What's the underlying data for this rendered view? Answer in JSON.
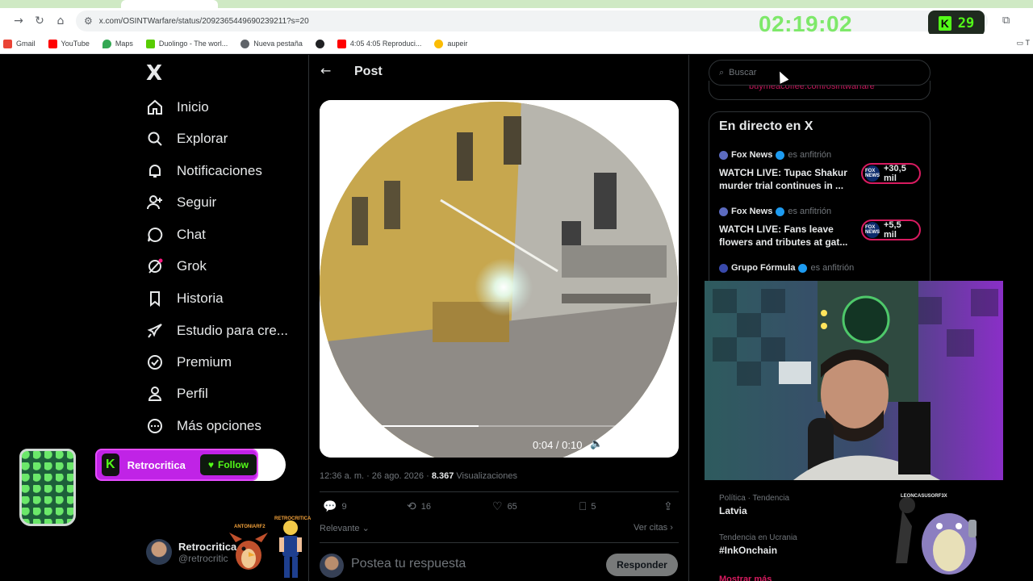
{
  "browser": {
    "url": "x.com/OSINTWarfare/status/2092365449690239211?s=20",
    "timer": "02:19:02",
    "kick_badge": "K",
    "kick_count": "29",
    "bookmarks": [
      {
        "label": "Gmail",
        "color": "#ea4335"
      },
      {
        "label": "YouTube",
        "color": "#ff0000"
      },
      {
        "label": "Maps",
        "color": "#34a853"
      },
      {
        "label": "Duolingo - The worl...",
        "color": "#58cc02"
      },
      {
        "label": "Nueva pestaña",
        "color": "#5f6368"
      },
      {
        "label": "",
        "color": "#202124"
      },
      {
        "label": "4:05 4:05 Reproduci...",
        "color": "#ff0000"
      },
      {
        "label": "aupeir",
        "color": "#fbbc04"
      }
    ],
    "bookmarks_more": "T"
  },
  "x": {
    "logo": "X",
    "nav": [
      {
        "label": "Inicio",
        "icon": "home-icon"
      },
      {
        "label": "Explorar",
        "icon": "search-icon"
      },
      {
        "label": "Notificaciones",
        "icon": "bell-icon"
      },
      {
        "label": "Seguir",
        "icon": "follow-icon"
      },
      {
        "label": "Chat",
        "icon": "chat-icon"
      },
      {
        "label": "Grok",
        "icon": "grok-icon"
      },
      {
        "label": "Historia",
        "icon": "bookmark-icon"
      },
      {
        "label": "Estudio para cre...",
        "icon": "rocket-icon"
      },
      {
        "label": "Premium",
        "icon": "verified-icon"
      },
      {
        "label": "Perfil",
        "icon": "person-icon"
      },
      {
        "label": "Más opciones",
        "icon": "more-icon"
      }
    ],
    "account": {
      "name": "Retrocritica",
      "handle": "@retrocritic"
    },
    "post": {
      "title": "Post",
      "video_time": "0:04 / 0:10",
      "progress": 0.44,
      "timestamp": "12:36 a. m. · 26 ago. 2026 · ",
      "views_count": "8.367",
      "views_label": "Visualizaciones",
      "replies": "9",
      "reposts": "16",
      "likes": "65",
      "bookmarks": "5",
      "sort_label": "Relevante",
      "quotes_label": "Ver citas",
      "reply_placeholder": "Postea tu respuesta",
      "reply_button": "Responder"
    },
    "search_placeholder": "Buscar",
    "peek_text": "buymeacoffee.com/osintwarfare",
    "live": {
      "title": "En directo en X",
      "items": [
        {
          "host": "Fox News",
          "role": "es anfitrión",
          "headline": "WATCH LIVE: Tupac Shakur murder trial continues in ...",
          "viewers": "+30,5 mil",
          "logo": "FOX NEWS"
        },
        {
          "host": "Fox News",
          "role": "es anfitrión",
          "headline": "WATCH LIVE: Fans leave flowers and tributes at gat...",
          "viewers": "+5,5 mil",
          "logo": "FOX NEWS"
        },
        {
          "host": "Grupo Fórmula",
          "role": "es anfitrión"
        }
      ]
    },
    "trends": [
      {
        "meta": "Política · Tendencia",
        "name": "Latvia"
      },
      {
        "meta": "Tendencia en Ucrania",
        "name": "#InkOnchain"
      }
    ],
    "trend_cut": "Mostrar más"
  },
  "overlay": {
    "follow_name": "Retrocritica",
    "follow_button": "Follow",
    "kick_letter": "K",
    "sprite_tag_1": "ANTONIARF2",
    "sprite_tag_2": "RETROCRITICA",
    "monster_tag": "LEONCASUSORF3X"
  }
}
